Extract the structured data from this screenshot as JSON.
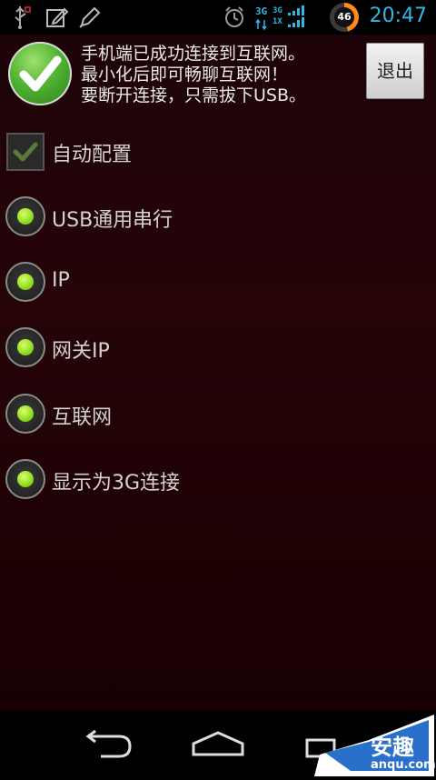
{
  "status_bar": {
    "time": "20:47",
    "network_top": "3G",
    "network_top2": "3G",
    "network_bottom": "1X",
    "battery_level": "46",
    "accent_color": "#33b5e5"
  },
  "connection": {
    "message_lines": [
      "手机端已成功连接到互联网。",
      "最小化后即可畅聊互联网！",
      "要断开连接，只需拔下USB。"
    ],
    "exit_label": "退出"
  },
  "options": {
    "auto_config": {
      "label": "自动配置",
      "checked": true
    },
    "radios": [
      {
        "label": "USB通用串行",
        "selected": true
      },
      {
        "label": "IP",
        "selected": true
      },
      {
        "label": "网关IP",
        "selected": true
      },
      {
        "label": "互联网",
        "selected": true
      },
      {
        "label": "显示为3G连接",
        "selected": true
      }
    ]
  },
  "navigation": {
    "back": "back-icon",
    "home": "home-icon",
    "recents": "recents-icon"
  },
  "watermark": {
    "brand": "安趣",
    "domain": "anqu.com"
  }
}
